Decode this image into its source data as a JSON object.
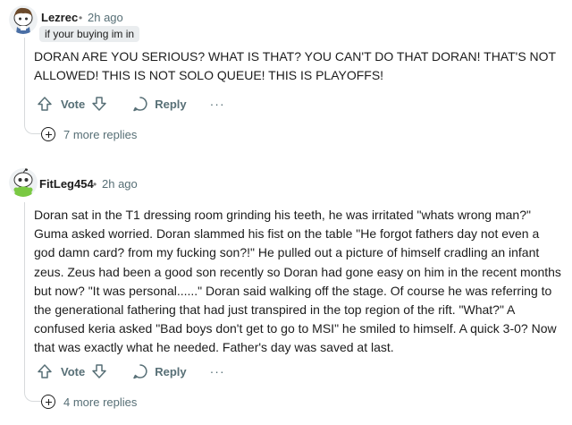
{
  "comments": [
    {
      "author": "Lezrec",
      "dot": "•",
      "time": "2h ago",
      "flair": "if your buying im in",
      "body": "DORAN ARE YOU SERIOUS? WHAT IS THAT? YOU CAN'T DO THAT DORAN! THAT'S NOT ALLOWED! THIS IS NOT SOLO QUEUE! THIS IS PLAYOFFS!",
      "vote_label": "Vote",
      "reply_label": "Reply",
      "more_label": "···",
      "more_replies": "7 more replies",
      "avatar_icon": "snoo-avatar-icon"
    },
    {
      "author": "FitLeg454",
      "dot": "•",
      "time": "2h ago",
      "body": "Doran sat in the T1 dressing room grinding his teeth, he was irritated \"whats wrong man?\" Guma asked worried. Doran slammed his fist on the table \"He forgot fathers day not even a god damn card? from my fucking son?!\" He pulled out a picture of himself cradling an infant zeus. Zeus had been a good son recently so Doran had gone easy on him in the recent months but now? \"It was personal......\" Doran said walking off the stage. Of course he was referring to the generational fathering that had just transpired in the top region of the rift. \"What?\" A confused keria asked \"Bad boys don't get to go to MSI\" he smiled to himself. A quick 3-0? Now that was exactly what he needed. Father's day was saved at last.",
      "vote_label": "Vote",
      "reply_label": "Reply",
      "more_label": "···",
      "more_replies": "4 more replies",
      "avatar_icon": "snoo-avatar-icon"
    }
  ],
  "colors": {
    "text": "#1c1c1c",
    "meta": "#576f76",
    "flair_bg": "#eaedef",
    "thread_line": "#d7dadc"
  }
}
